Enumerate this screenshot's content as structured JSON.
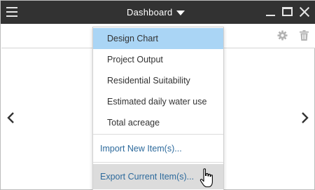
{
  "titlebar": {
    "title": "Dashboard"
  },
  "menu": {
    "items": [
      {
        "label": "Design Chart",
        "selected": true
      },
      {
        "label": "Project Output",
        "selected": false
      },
      {
        "label": "Residential Suitability",
        "selected": false
      },
      {
        "label": "Estimated daily water use",
        "selected": false
      },
      {
        "label": "Total acreage",
        "selected": false
      }
    ],
    "import_label": "Import New Item(s)...",
    "export_label": "Export Current Item(s)..."
  },
  "colors": {
    "titlebar_bg": "#323232",
    "selected_bg": "#aad5f5",
    "link_text": "#2d6a9c",
    "hover_bg": "#dcdcdc"
  },
  "icons": {
    "menu": "hamburger-icon",
    "caret": "caret-down-icon",
    "minimize": "minimize-icon",
    "maximize": "maximize-icon",
    "close": "close-icon",
    "settings": "gear-icon",
    "delete": "trash-icon",
    "previous": "chevron-left-icon",
    "next": "chevron-right-icon",
    "pointer": "hand-cursor-icon"
  }
}
